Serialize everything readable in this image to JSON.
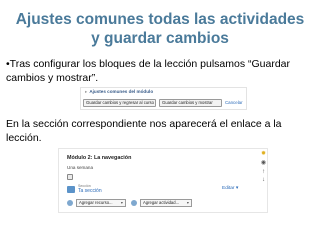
{
  "slide": {
    "title": "Ajustes comunes todas las actividades y guardar cambios",
    "bullet_text": "•Tras configurar  los bloques de la lección pulsamos “Guardar cambios y mostrar”.",
    "paragraph_text": "En la sección correspondiente nos aparecerá el enlace a la lección."
  },
  "screenshot_form": {
    "section_header": "Ajustes comunes del módulo",
    "save_return_label": "Guardar cambios y regresar al curso",
    "save_show_label": "Guardar cambios y mostrar",
    "cancel_label": "Cancelar"
  },
  "screenshot_course": {
    "topic_title": "Módulo 2: La navegación",
    "topic_subtitle": "Una semana",
    "lesson_small_label": "Sección",
    "lesson_link": "Ta sección",
    "edit_label": "Editar",
    "add_resource_label": "Agregar recurso...",
    "add_activity_label": "Agregar actividad..."
  },
  "colors": {
    "title": "#4a7a9a",
    "link": "#2a6ab8"
  },
  "icons": [
    "lightbulb-icon",
    "eye-icon",
    "move-icon",
    "delete-icon",
    "add-icon",
    "lesson-icon"
  ]
}
